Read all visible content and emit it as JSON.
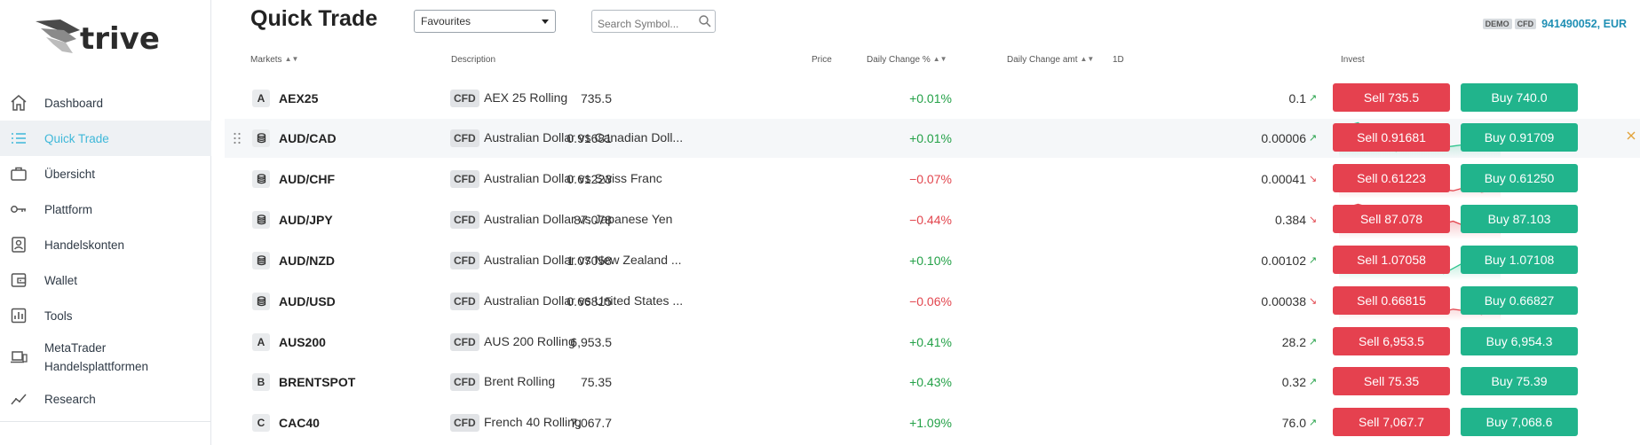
{
  "brand": {
    "name": "trive"
  },
  "sidebar": {
    "items": [
      {
        "label": "Dashboard",
        "icon": "home-icon"
      },
      {
        "label": "Quick Trade",
        "icon": "list-icon",
        "active": true
      },
      {
        "label": "Übersicht",
        "icon": "briefcase-icon"
      },
      {
        "label": "Plattform",
        "icon": "key-icon"
      },
      {
        "label": "Handelskonten",
        "icon": "account-card-icon"
      },
      {
        "label": "Wallet",
        "icon": "wallet-icon"
      },
      {
        "label": "Tools",
        "icon": "chart-tools-icon"
      },
      {
        "label": "MetaTrader Handelsplattformen",
        "label_line1": "MetaTrader",
        "label_line2": "Handelsplattformen",
        "icon": "laptop-icon"
      },
      {
        "label": "Research",
        "icon": "trend-icon"
      }
    ]
  },
  "header": {
    "title": "Quick Trade",
    "list_select": "Favourites",
    "search_placeholder": "Search Symbol...",
    "account": {
      "tag1": "DEMO",
      "tag2": "CFD",
      "number": "941490052, EUR"
    }
  },
  "table": {
    "columns": {
      "markets": "Markets",
      "description": "Description",
      "price": "Price",
      "daily_change_pct": "Daily Change %",
      "daily_change_amt": "Daily Change amt",
      "period": "1D",
      "invest": "Invest"
    },
    "rows": [
      {
        "badge": "A",
        "symbol": "AEX25",
        "type": "CFD",
        "description": "AEX 25 Rolling",
        "price": "735.5",
        "change_pct": "+0.01%",
        "change_amt": "0.1",
        "direction": "up",
        "sell": "Sell 735.5",
        "buy": "Buy 740.0"
      },
      {
        "badge": "coin",
        "symbol": "AUD/CAD",
        "type": "CFD",
        "description": "Australian Dollar vs Canadian Doll...",
        "price": "0.91681",
        "change_pct": "+0.01%",
        "change_amt": "0.00006",
        "direction": "up",
        "sell": "Sell 0.91681",
        "buy": "Buy 0.91709",
        "highlight": true,
        "spark": [
          62,
          60,
          58,
          63,
          70,
          72,
          80,
          78,
          79,
          76,
          75,
          77,
          76,
          75,
          74,
          78,
          76,
          70
        ]
      },
      {
        "badge": "coin",
        "symbol": "AUD/CHF",
        "type": "CFD",
        "description": "Australian Dollar vs Swiss Franc",
        "price": "0.61223",
        "change_pct": "−0.07%",
        "change_amt": "0.00041",
        "direction": "down",
        "sell": "Sell 0.61223",
        "buy": "Buy 0.61250",
        "spark": [
          62,
          61,
          60,
          62,
          68,
          70,
          71,
          74,
          73,
          72,
          76,
          78,
          79,
          77,
          78,
          80,
          79,
          78
        ]
      },
      {
        "badge": "coin",
        "symbol": "AUD/JPY",
        "type": "CFD",
        "description": "Australian Dollar vs Japanese Yen",
        "price": "87.078",
        "change_pct": "−0.44%",
        "change_amt": "0.384",
        "direction": "down",
        "sell": "Sell 87.078",
        "buy": "Buy 87.103",
        "spark": [
          60,
          60,
          58,
          60,
          63,
          62,
          64,
          66,
          65,
          64,
          72,
          73,
          71,
          74,
          75,
          78,
          76,
          80
        ]
      },
      {
        "badge": "coin",
        "symbol": "AUD/NZD",
        "type": "CFD",
        "description": "Australian Dollar vs New Zealand ...",
        "price": "1.07058",
        "change_pct": "+0.10%",
        "change_amt": "0.00102",
        "direction": "up",
        "sell": "Sell 1.07058",
        "buy": "Buy 1.07108",
        "spark": [
          62,
          60,
          62,
          66,
          70,
          72,
          74,
          74,
          76,
          73,
          76,
          80,
          76,
          72,
          73,
          72,
          71,
          66
        ]
      },
      {
        "badge": "coin",
        "symbol": "AUD/USD",
        "type": "CFD",
        "description": "Australian Dollar vs United States ...",
        "price": "0.66815",
        "change_pct": "−0.06%",
        "change_amt": "0.00038",
        "direction": "down",
        "sell": "Sell 0.66815",
        "buy": "Buy 0.66827",
        "spark": [
          60,
          59,
          62,
          61,
          62,
          64,
          70,
          72,
          71,
          73,
          76,
          78,
          76,
          77,
          78,
          80,
          76,
          80
        ]
      },
      {
        "badge": "A",
        "symbol": "AUS200",
        "type": "CFD",
        "description": "AUS 200 Rolling",
        "price": "6,953.5",
        "change_pct": "+0.41%",
        "change_amt": "28.2",
        "direction": "up",
        "sell": "Sell 6,953.5",
        "buy": "Buy 6,954.3"
      },
      {
        "badge": "B",
        "symbol": "BRENTSPOT",
        "type": "CFD",
        "description": "Brent Rolling",
        "price": "75.35",
        "change_pct": "+0.43%",
        "change_amt": "0.32",
        "direction": "up",
        "sell": "Sell 75.35",
        "buy": "Buy 75.39"
      },
      {
        "badge": "C",
        "symbol": "CAC40",
        "type": "CFD",
        "description": "French 40 Rolling",
        "price": "7,067.7",
        "change_pct": "+1.09%",
        "change_amt": "76.0",
        "direction": "up",
        "sell": "Sell 7,067.7",
        "buy": "Buy 7,068.6"
      }
    ]
  },
  "colors": {
    "accent": "#3fb8d9",
    "sell": "#e5414f",
    "buy": "#21b48c",
    "positive": "#24a148",
    "negative": "#e2464e"
  }
}
